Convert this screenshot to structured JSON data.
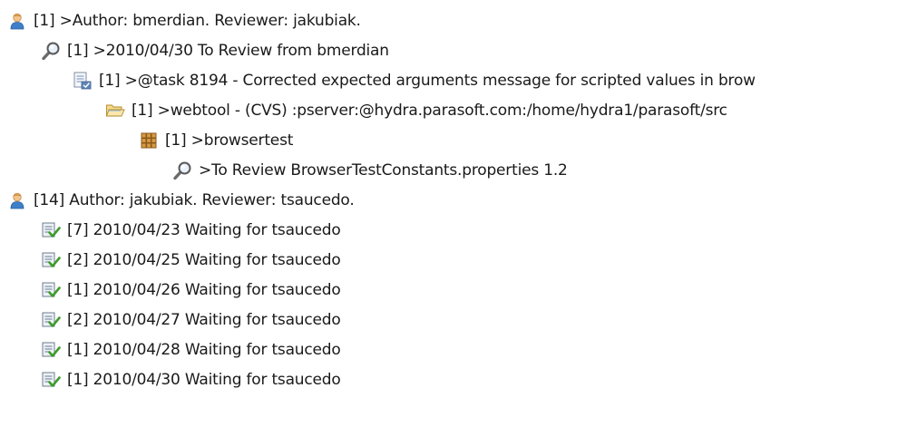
{
  "tree": {
    "rows": [
      {
        "label": "[1] >Author: bmerdian. Reviewer: jakubiak.",
        "icon": "user-icon"
      },
      {
        "label": "[1] >2010/04/30 To Review from bmerdian",
        "icon": "magnifier-icon"
      },
      {
        "label": "[1] >@task 8194 - Corrected expected arguments message for scripted values in brow",
        "icon": "task-icon"
      },
      {
        "label": "[1] >webtool  - (CVS) :pserver:@hydra.parasoft.com:/home/hydra1/parasoft/src",
        "icon": "folder-open-icon"
      },
      {
        "label": "[1] >browsertest",
        "icon": "package-icon"
      },
      {
        "label": ">To Review BrowserTestConstants.properties  1.2",
        "icon": "magnifier-icon"
      },
      {
        "label": "[14] Author: jakubiak. Reviewer: tsaucedo.",
        "icon": "user-icon"
      },
      {
        "label": "[7] 2010/04/23 Waiting for tsaucedo",
        "icon": "waiting-review-icon"
      },
      {
        "label": "[2] 2010/04/25 Waiting for tsaucedo",
        "icon": "waiting-review-icon"
      },
      {
        "label": "[1] 2010/04/26 Waiting for tsaucedo",
        "icon": "waiting-review-icon"
      },
      {
        "label": "[2] 2010/04/27 Waiting for tsaucedo",
        "icon": "waiting-review-icon"
      },
      {
        "label": "[1] 2010/04/28 Waiting for tsaucedo",
        "icon": "waiting-review-icon"
      },
      {
        "label": "[1] 2010/04/30 Waiting for tsaucedo",
        "icon": "waiting-review-icon"
      }
    ]
  }
}
